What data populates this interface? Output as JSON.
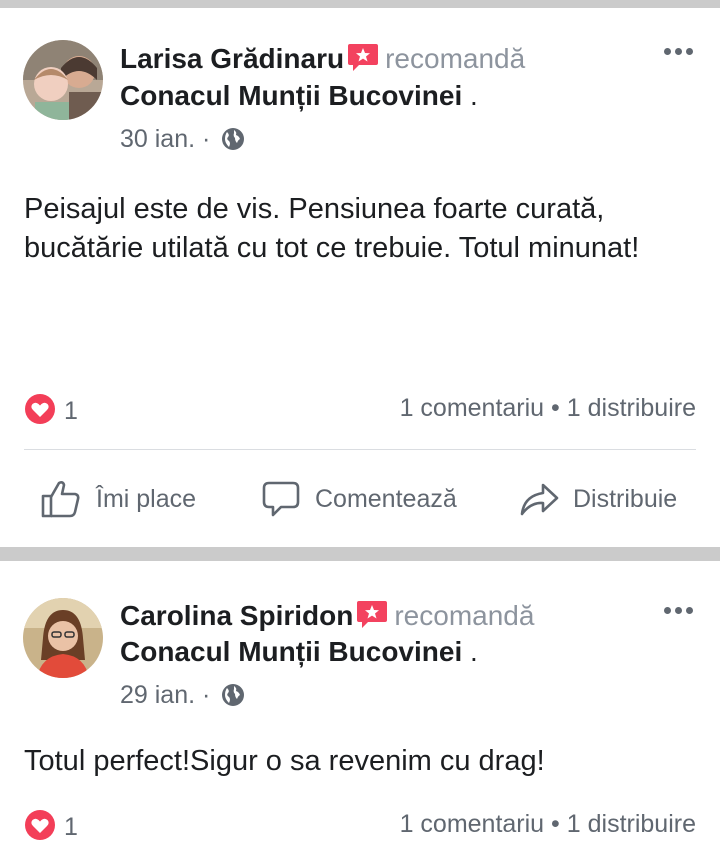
{
  "posts": [
    {
      "author": "Larisa Grădinaru",
      "verb": "recomandă",
      "page": "Conacul Munții Bucovinei",
      "page_suffix": " .",
      "date": "30 ian.",
      "date_separator": "·",
      "text": "Peisajul este de vis. Pensiunea foarte curată, bucătărie utilată cu tot ce trebuie. Totul minunat!",
      "reaction_count": "1",
      "comments": "1 comentariu",
      "stats_separator": "•",
      "shares": "1 distribuire",
      "actions": {
        "like": "Îmi place",
        "comment": "Comentează",
        "share": "Distribuie"
      }
    },
    {
      "author": "Carolina Spiridon",
      "verb": "recomandă",
      "page": "Conacul Munții Bucovinei",
      "page_suffix": " .",
      "date": "29 ian.",
      "date_separator": "·",
      "text": "Totul perfect!Sigur o sa revenim cu drag!",
      "reaction_count": "1",
      "comments": "1 comentariu",
      "stats_separator": "•",
      "shares": "1 distribuire"
    }
  ],
  "colors": {
    "recommend_badge": "#f3425f",
    "heart": "#f33e58",
    "secondary_text": "#606770",
    "separator": "#cbcbcb"
  },
  "icons": [
    "recommend-icon",
    "globe-icon",
    "more-icon",
    "heart-icon",
    "like-icon",
    "comment-icon",
    "share-icon"
  ]
}
